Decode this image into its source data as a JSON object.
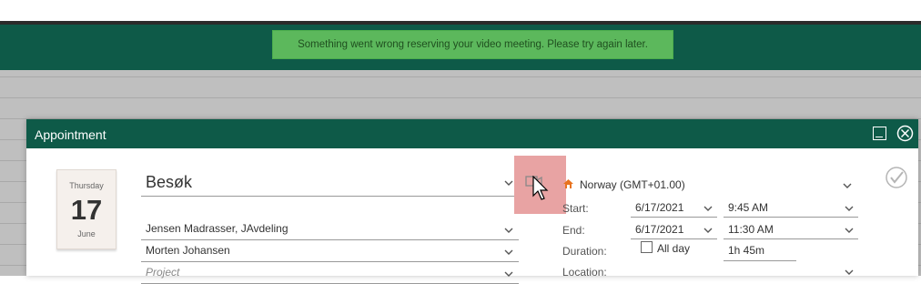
{
  "toast": {
    "message": "Something went wrong reserving your video meeting. Please try again later."
  },
  "dialog": {
    "title": "Appointment",
    "date": {
      "weekday": "Thursday",
      "day": "17",
      "month": "June"
    },
    "subject": "Besøk",
    "company": "Jensen Madrasser, JAvdeling",
    "contact": "Morten Johansen",
    "project_placeholder": "Project",
    "timezone": "Norway (GMT+01.00)",
    "start_label": "Start:",
    "start_date": "6/17/2021",
    "start_time": "9:45 AM",
    "end_label": "End:",
    "end_date": "6/17/2021",
    "end_time": "11:30 AM",
    "duration_label": "Duration:",
    "allday_label": "All day",
    "duration_value": "1h 45m",
    "location_label": "Location:"
  },
  "colors": {
    "header": "#0e5a48",
    "toast_bg": "#5cb85c",
    "highlight": "#e8a3a3"
  }
}
